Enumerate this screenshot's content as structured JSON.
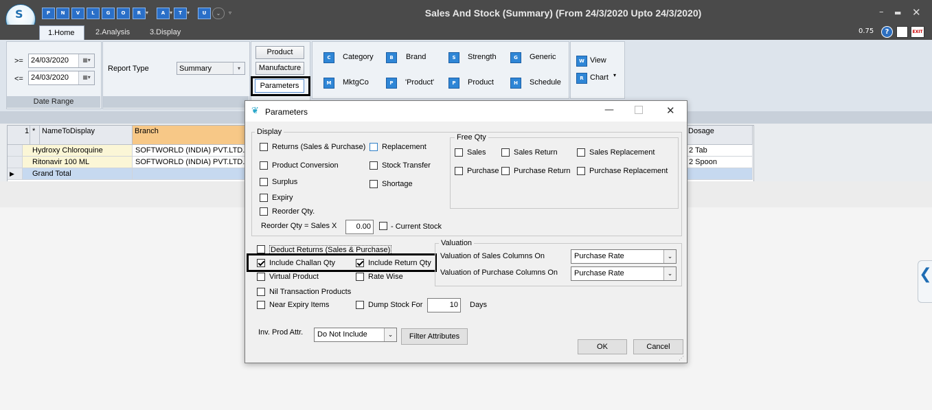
{
  "window": {
    "title": "Sales And Stock (Summary)  (From 24/3/2020 Upto 24/3/2020)",
    "zoom": "0.75",
    "quick_access": [
      "P",
      "N",
      "V",
      "L",
      "G",
      "O",
      "R",
      "A",
      "T",
      "U"
    ]
  },
  "tabs": [
    "1.Home",
    "2.Analysis",
    "3.Display"
  ],
  "ribbon": {
    "date_range": {
      "from_op": ">=",
      "from_value": "24/03/2020",
      "to_op": "<=",
      "to_value": "24/03/2020",
      "group_label": "Date Range"
    },
    "report_type_label": "Report Type",
    "report_type_value": "Summary",
    "buttons": {
      "product": "Product",
      "manufacture": "Manufacture",
      "parameters": "Parameters"
    },
    "items": {
      "category": "Category",
      "brand": "Brand",
      "strength": "Strength",
      "generic": "Generic",
      "mktgco": "MktgCo",
      "product_q": "'Product'",
      "product": "Product",
      "schedule": "Schedule"
    },
    "view": "View",
    "chart": "Chart"
  },
  "grid": {
    "row_num_header": "1",
    "star_header": "*",
    "headers": {
      "name": "NameToDisplay",
      "branch": "Branch",
      "dosage": "Dosage"
    },
    "rows": [
      {
        "name": "Hydroxy Chloroquine",
        "branch": "SOFTWORLD (INDIA) PVT.LTD.",
        "dosage": "2 Tab"
      },
      {
        "name": "Ritonavir 100 ML",
        "branch": "SOFTWORLD (INDIA) PVT.LTD.",
        "dosage": "2 Spoon"
      }
    ],
    "total_label": "Grand Total"
  },
  "dialog": {
    "title": "Parameters",
    "display_legend": "Display",
    "display_items": {
      "returns": "Returns (Sales & Purchase)",
      "replacement": "Replacement",
      "product_conversion": "Product Conversion",
      "stock_transfer": "Stock Transfer",
      "surplus": "Surplus",
      "shortage": "Shortage",
      "expiry": "Expiry",
      "reorder_qty": "Reorder Qty."
    },
    "reorder_label": "Reorder Qty = Sales X",
    "reorder_value": "0.00",
    "current_stock": "- Current Stock",
    "free_qty_legend": "Free Qty",
    "free_qty": {
      "sales": "Sales",
      "sales_return": "Sales Return",
      "sales_replacement": "Sales Replacement",
      "purchase": "Purchase",
      "purchase_return": "Purchase Return",
      "purchase_replacement": "Purchase Replacement"
    },
    "options": {
      "deduct_returns": "Deduct Returns  (Sales & Purchase)",
      "include_challan": "Include Challan Qty",
      "include_return": "Include Return Qty",
      "virtual_product": "Virtual Product",
      "rate_wise": "Rate Wise",
      "nil_transaction": "Nil Transaction Products",
      "near_expiry": "Near Expiry Items",
      "dump_stock": "Dump Stock For",
      "dump_days_value": "10",
      "days": "Days"
    },
    "valuation": {
      "legend": "Valuation",
      "sales_label": "Valuation of Sales Columns On",
      "sales_value": "Purchase Rate",
      "purchase_label": "Valuation of Purchase Columns On",
      "purchase_value": "Purchase Rate"
    },
    "inv_prod_attr_label": "Inv. Prod Attr.",
    "inv_prod_attr_value": "Do Not Include",
    "filter_attributes": "Filter Attributes",
    "ok": "OK",
    "cancel": "Cancel"
  }
}
